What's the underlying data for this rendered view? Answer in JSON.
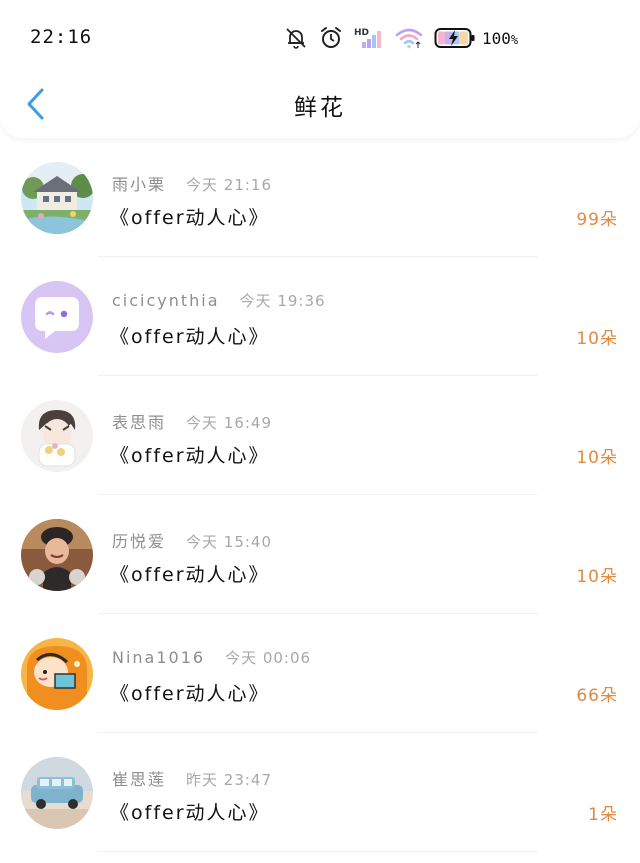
{
  "status_bar": {
    "time": "22:16",
    "battery": "100",
    "battery_unit": "%",
    "icons": [
      "bell-muted-icon",
      "alarm-clock-icon",
      "hd-signal-icon",
      "wifi-icon",
      "battery-charging-icon"
    ],
    "signal_badge": "HD"
  },
  "header": {
    "title": "鲜花",
    "back_icon": "chevron-left-icon",
    "accent": "#3a9be6"
  },
  "colors": {
    "count": "#e08a42",
    "name": "#8e8e8e",
    "time": "#a8a8a8"
  },
  "records": [
    {
      "name": "雨小栗",
      "time": "今天 21:16",
      "gift": "《offer动人心》",
      "count": "99朵",
      "avatar": "house-landscape-avatar"
    },
    {
      "name": "cicicynthia",
      "time": "今天 19:36",
      "gift": "《offer动人心》",
      "count": "10朵",
      "avatar": "purple-chat-bubble-avatar"
    },
    {
      "name": "表思雨",
      "time": "今天 16:49",
      "gift": "《offer动人心》",
      "count": "10朵",
      "avatar": "anime-boy-avatar"
    },
    {
      "name": "历悦爱",
      "time": "今天 15:40",
      "gift": "《offer动人心》",
      "count": "10朵",
      "avatar": "person-photo-avatar"
    },
    {
      "name": "Nina1016",
      "time": "今天 00:06",
      "gift": "《offer动人心》",
      "count": "66朵",
      "avatar": "cartoon-orange-avatar"
    },
    {
      "name": "崔思莲",
      "time": "昨天 23:47",
      "gift": "《offer动人心》",
      "count": "1朵",
      "avatar": "blue-car-avatar"
    }
  ]
}
